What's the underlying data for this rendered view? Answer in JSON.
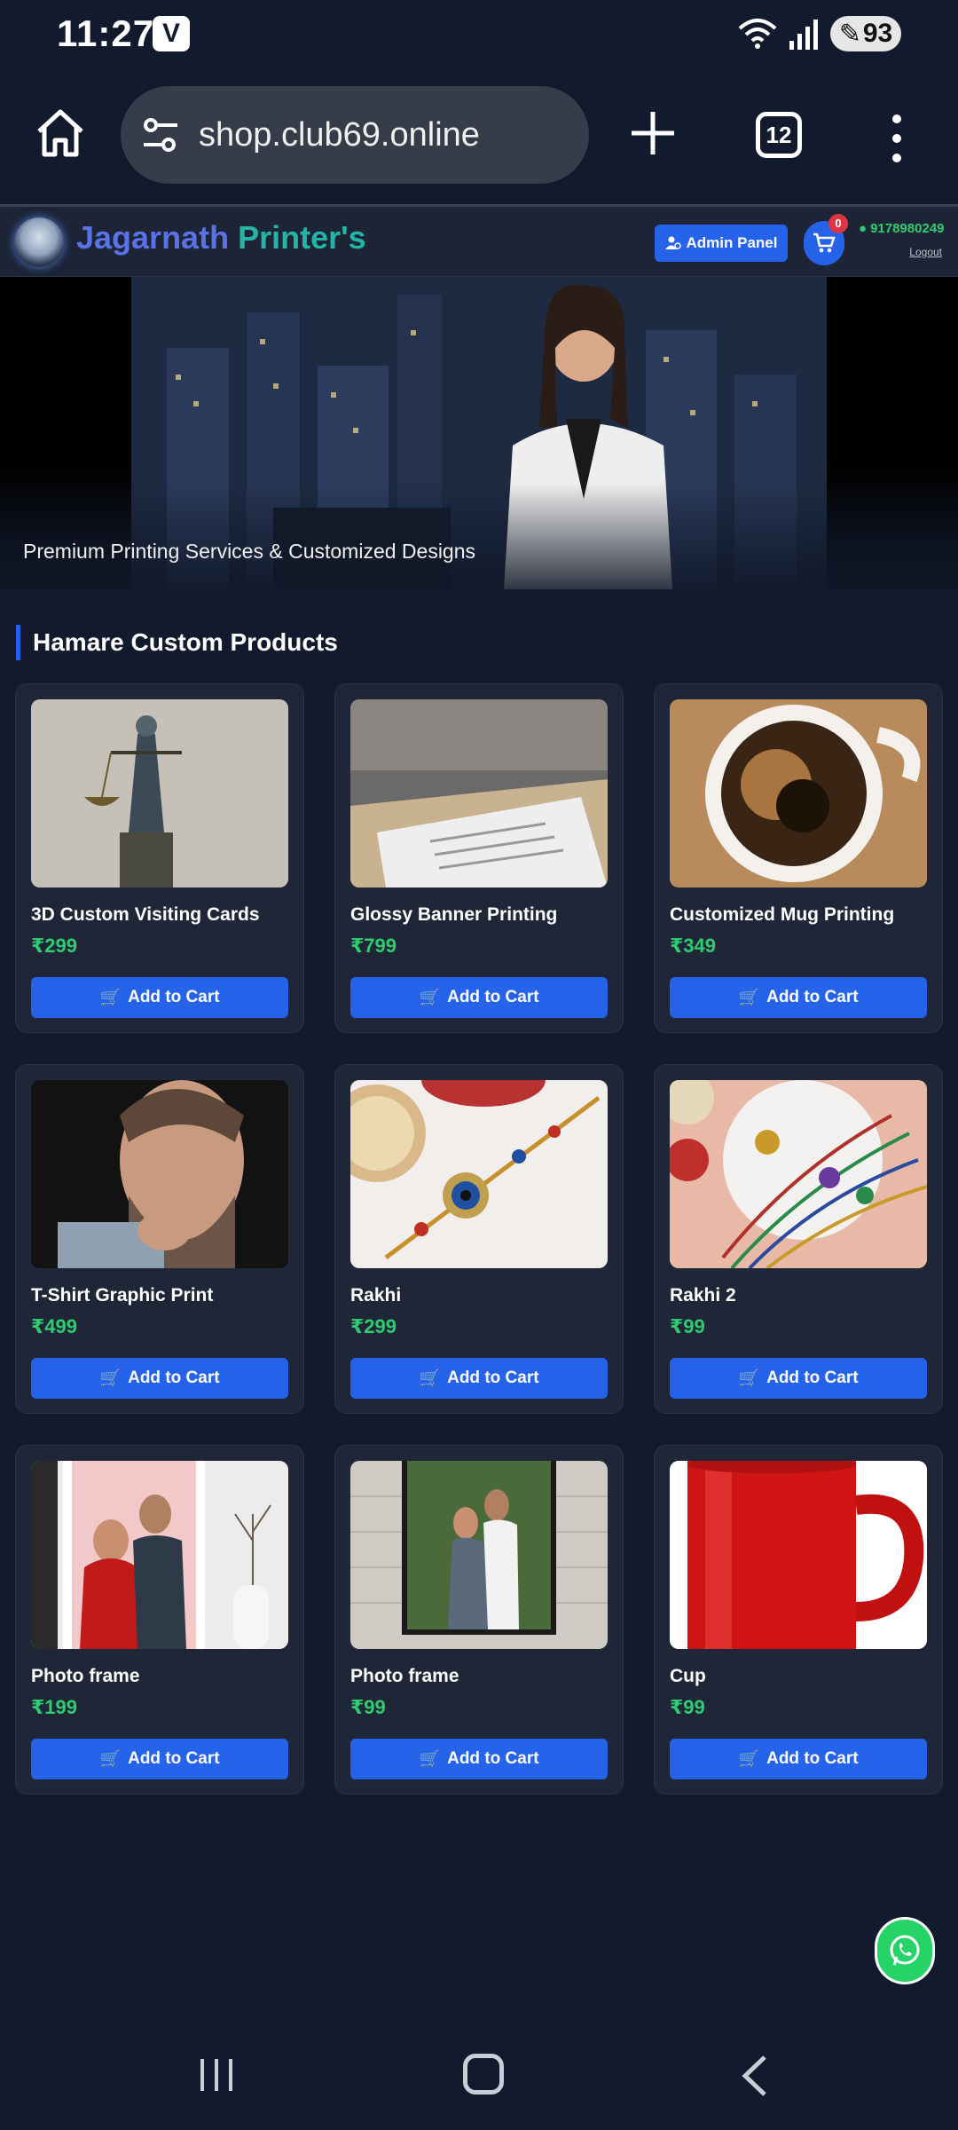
{
  "status_bar": {
    "time": "11:27",
    "app_badge": "V",
    "battery": "93"
  },
  "browser": {
    "url": "shop.club69.online",
    "tab_count": "12"
  },
  "site": {
    "brand_part1": "Jagarnath ",
    "brand_part2": "Printer's",
    "admin_label": "Admin Panel",
    "cart_count": "0",
    "phone": "9178980249",
    "logout": "Logout"
  },
  "hero": {
    "caption": "Premium Printing Services & Customized Designs"
  },
  "section": {
    "title": "Hamare Custom Products"
  },
  "products": [
    {
      "name": "3D Custom Visiting Cards",
      "price": "₹299",
      "button": "Add to Cart"
    },
    {
      "name": "Glossy Banner Printing",
      "price": "₹799",
      "button": "Add to Cart"
    },
    {
      "name": "Customized Mug Printing",
      "price": "₹349",
      "button": "Add to Cart"
    },
    {
      "name": "T-Shirt Graphic Print",
      "price": "₹499",
      "button": "Add to Cart"
    },
    {
      "name": "Rakhi",
      "price": "₹299",
      "button": "Add to Cart"
    },
    {
      "name": "Rakhi 2",
      "price": "₹99",
      "button": "Add to Cart"
    },
    {
      "name": "Photo frame",
      "price": "₹199",
      "button": "Add to Cart"
    },
    {
      "name": "Photo frame",
      "price": "₹99",
      "button": "Add to Cart"
    },
    {
      "name": "Cup",
      "price": "₹99",
      "button": "Add to Cart"
    }
  ],
  "colors": {
    "accent": "#2563eb",
    "price": "#2ecc71",
    "background": "#121a2e",
    "card": "#1e2637"
  }
}
